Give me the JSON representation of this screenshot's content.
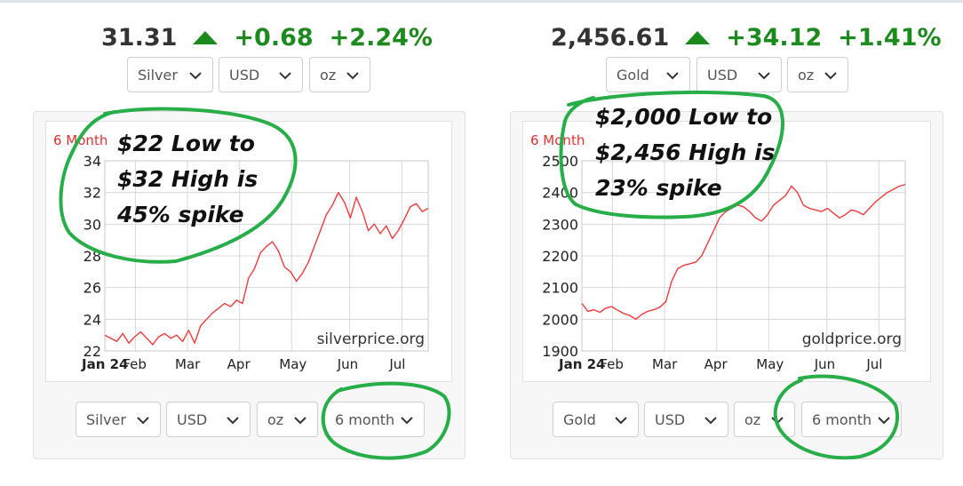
{
  "colors": {
    "up": "#1d8a1d",
    "line": "#ee3b3b",
    "period_label": "#e03030",
    "circle": "#27ae48",
    "grid": "#d8d8d8"
  },
  "panels": [
    {
      "metal": "silver",
      "quote": {
        "price": "31.31",
        "change": "+0.68",
        "change_pct": "+2.24%",
        "direction": "up-arrow-icon"
      },
      "top_selects": [
        "Silver",
        "USD",
        "oz"
      ],
      "bottom_selects": [
        "Silver",
        "USD",
        "oz",
        "6 month"
      ],
      "annotation": [
        "$22 Low to",
        "$32 High is",
        "45% spike"
      ],
      "chart_data": {
        "type": "line",
        "period_label": "6 Month",
        "watermark": "silverprice.org",
        "yticks": [
          "22",
          "24",
          "26",
          "28",
          "30",
          "32",
          "34"
        ],
        "ylim": [
          22,
          34
        ],
        "xticks": [
          {
            "label": "Jan 24",
            "x": 0
          },
          {
            "label": "Feb",
            "x": 5.1
          },
          {
            "label": "Mar",
            "x": 13.8
          },
          {
            "label": "Apr",
            "x": 22.5
          },
          {
            "label": "May",
            "x": 31.2
          },
          {
            "label": "Jun",
            "x": 40.9
          },
          {
            "label": "Jul",
            "x": 49.6
          }
        ],
        "xlim": [
          0,
          54
        ],
        "series": [
          {
            "values": [
              [
                0,
                23.0
              ],
              [
                1,
                22.8
              ],
              [
                2,
                22.6
              ],
              [
                3,
                23.1
              ],
              [
                4,
                22.5
              ],
              [
                5,
                22.9
              ],
              [
                6,
                23.2
              ],
              [
                7,
                22.8
              ],
              [
                8,
                22.4
              ],
              [
                9,
                22.9
              ],
              [
                10,
                23.1
              ],
              [
                11,
                22.8
              ],
              [
                12,
                23.0
              ],
              [
                13,
                22.6
              ],
              [
                14,
                23.3
              ],
              [
                15,
                22.5
              ],
              [
                16,
                23.6
              ],
              [
                17,
                24.0
              ],
              [
                18,
                24.4
              ],
              [
                19,
                24.7
              ],
              [
                20,
                25.0
              ],
              [
                21,
                24.8
              ],
              [
                22,
                25.2
              ],
              [
                23,
                25.0
              ],
              [
                24,
                26.6
              ],
              [
                25,
                27.2
              ],
              [
                26,
                28.2
              ],
              [
                27,
                28.6
              ],
              [
                28,
                28.9
              ],
              [
                29,
                28.3
              ],
              [
                30,
                27.3
              ],
              [
                31,
                27.0
              ],
              [
                32,
                26.4
              ],
              [
                33,
                26.9
              ],
              [
                34,
                27.6
              ],
              [
                35,
                28.6
              ],
              [
                36,
                29.6
              ],
              [
                37,
                30.6
              ],
              [
                38,
                31.2
              ],
              [
                39,
                32.0
              ],
              [
                40,
                31.4
              ],
              [
                41,
                30.4
              ],
              [
                42,
                31.7
              ],
              [
                43,
                30.8
              ],
              [
                44,
                29.6
              ],
              [
                45,
                30.0
              ],
              [
                46,
                29.4
              ],
              [
                47,
                29.9
              ],
              [
                48,
                29.1
              ],
              [
                49,
                29.6
              ],
              [
                50,
                30.3
              ],
              [
                51,
                31.1
              ],
              [
                52,
                31.3
              ],
              [
                53,
                30.8
              ],
              [
                54,
                31.0
              ]
            ]
          }
        ]
      }
    },
    {
      "metal": "gold",
      "quote": {
        "price": "2,456.61",
        "change": "+34.12",
        "change_pct": "+1.41%",
        "direction": "up-arrow-icon"
      },
      "top_selects": [
        "Gold",
        "USD",
        "oz"
      ],
      "bottom_selects": [
        "Gold",
        "USD",
        "oz",
        "6 month"
      ],
      "annotation": [
        "$2,000 Low to",
        "$2,456 High is",
        "23% spike"
      ],
      "chart_data": {
        "type": "line",
        "period_label": "6 Month",
        "watermark": "goldprice.org",
        "yticks": [
          "1900",
          "2000",
          "2100",
          "2200",
          "2300",
          "2400",
          "2500"
        ],
        "ylim": [
          1900,
          2500
        ],
        "xticks": [
          {
            "label": "Jan 24",
            "x": 0
          },
          {
            "label": "Feb",
            "x": 5.1
          },
          {
            "label": "Mar",
            "x": 13.8
          },
          {
            "label": "Apr",
            "x": 22.5
          },
          {
            "label": "May",
            "x": 31.2
          },
          {
            "label": "Jun",
            "x": 40.9
          },
          {
            "label": "Jul",
            "x": 49.6
          }
        ],
        "xlim": [
          0,
          54
        ],
        "series": [
          {
            "values": [
              [
                0,
                2050
              ],
              [
                1,
                2025
              ],
              [
                2,
                2030
              ],
              [
                3,
                2022
              ],
              [
                4,
                2035
              ],
              [
                5,
                2040
              ],
              [
                6,
                2028
              ],
              [
                7,
                2018
              ],
              [
                8,
                2012
              ],
              [
                9,
                2000
              ],
              [
                10,
                2015
              ],
              [
                11,
                2025
              ],
              [
                12,
                2030
              ],
              [
                13,
                2038
              ],
              [
                14,
                2055
              ],
              [
                15,
                2120
              ],
              [
                16,
                2160
              ],
              [
                17,
                2170
              ],
              [
                18,
                2175
              ],
              [
                19,
                2180
              ],
              [
                20,
                2200
              ],
              [
                21,
                2240
              ],
              [
                22,
                2280
              ],
              [
                23,
                2320
              ],
              [
                24,
                2340
              ],
              [
                25,
                2350
              ],
              [
                26,
                2360
              ],
              [
                27,
                2355
              ],
              [
                28,
                2340
              ],
              [
                29,
                2320
              ],
              [
                30,
                2310
              ],
              [
                31,
                2330
              ],
              [
                32,
                2360
              ],
              [
                33,
                2375
              ],
              [
                34,
                2390
              ],
              [
                35,
                2420
              ],
              [
                36,
                2400
              ],
              [
                37,
                2360
              ],
              [
                38,
                2350
              ],
              [
                39,
                2345
              ],
              [
                40,
                2340
              ],
              [
                41,
                2350
              ],
              [
                42,
                2335
              ],
              [
                43,
                2320
              ],
              [
                44,
                2330
              ],
              [
                45,
                2345
              ],
              [
                46,
                2340
              ],
              [
                47,
                2330
              ],
              [
                48,
                2350
              ],
              [
                49,
                2370
              ],
              [
                50,
                2385
              ],
              [
                51,
                2400
              ],
              [
                52,
                2410
              ],
              [
                53,
                2420
              ],
              [
                54,
                2425
              ]
            ]
          }
        ]
      }
    }
  ]
}
